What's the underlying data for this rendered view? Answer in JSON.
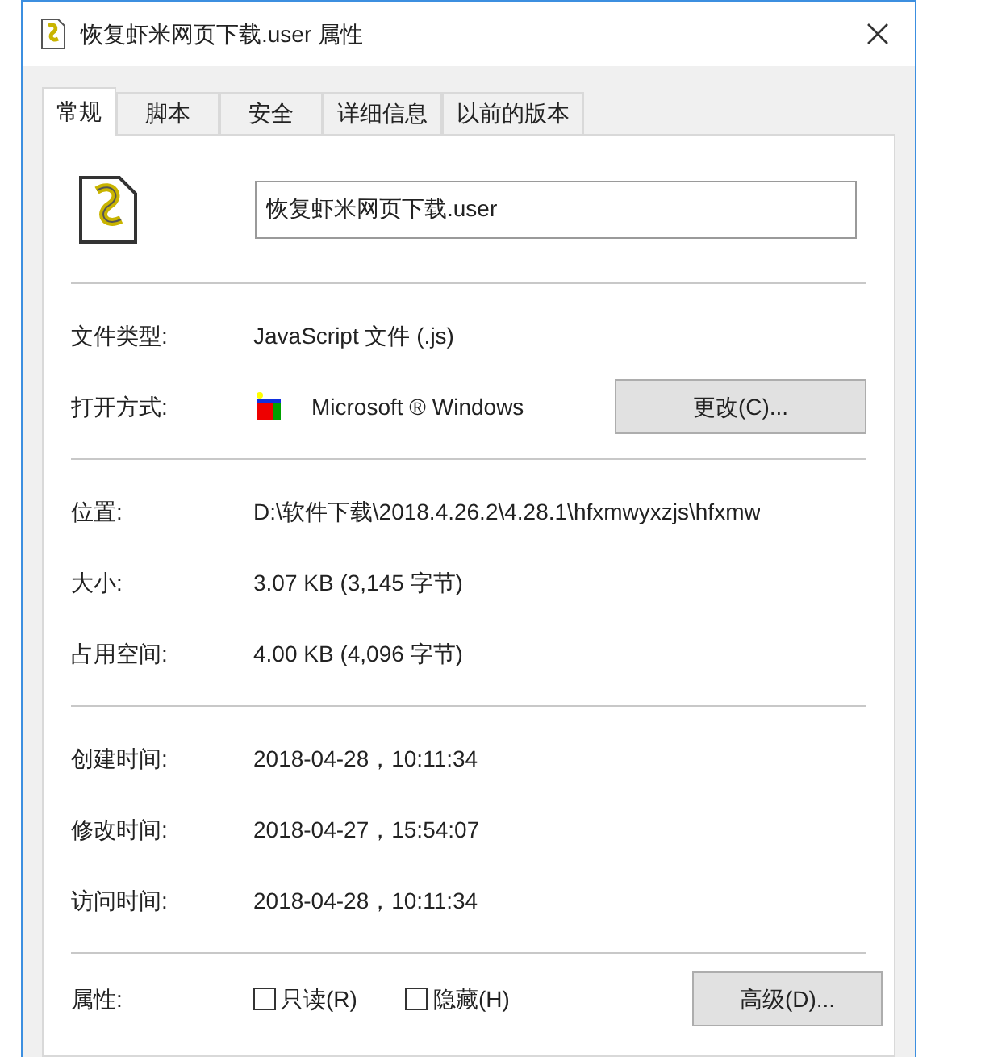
{
  "window": {
    "title": "恢复虾米网页下载.user 属性"
  },
  "tabs": [
    {
      "label": "常规",
      "selected": true
    },
    {
      "label": "脚本",
      "selected": false
    },
    {
      "label": "安全",
      "selected": false
    },
    {
      "label": "详细信息",
      "selected": false
    },
    {
      "label": "以前的版本",
      "selected": false
    }
  ],
  "file_name": {
    "value": "恢复虾米网页下载.user"
  },
  "sections": [
    [
      {
        "label": "文件类型:",
        "value": "JavaScript 文件 (.js)"
      },
      {
        "label": "打开方式:",
        "value": "Microsoft ® Windows",
        "button": "更改(C)..."
      }
    ],
    [
      {
        "label": "位置:",
        "value": "D:\\软件下载\\2018.4.26.2\\4.28.1\\hfxmwyxzjs\\hfxmw"
      },
      {
        "label": "大小:",
        "value": "3.07 KB (3,145 字节)"
      },
      {
        "label": "占用空间:",
        "value": "4.00 KB (4,096 字节)"
      }
    ],
    [
      {
        "label": "创建时间:",
        "value": "2018-04-28，10:11:34"
      },
      {
        "label": "修改时间:",
        "value": "2018-04-27，15:54:07"
      },
      {
        "label": "访问时间:",
        "value": "2018-04-28，10:11:34"
      }
    ]
  ],
  "attributes": {
    "label": "属性:",
    "checkboxes": [
      {
        "label": "只读(R)",
        "checked": false
      },
      {
        "label": "隐藏(H)",
        "checked": false
      }
    ],
    "button": "高级(D)..."
  }
}
